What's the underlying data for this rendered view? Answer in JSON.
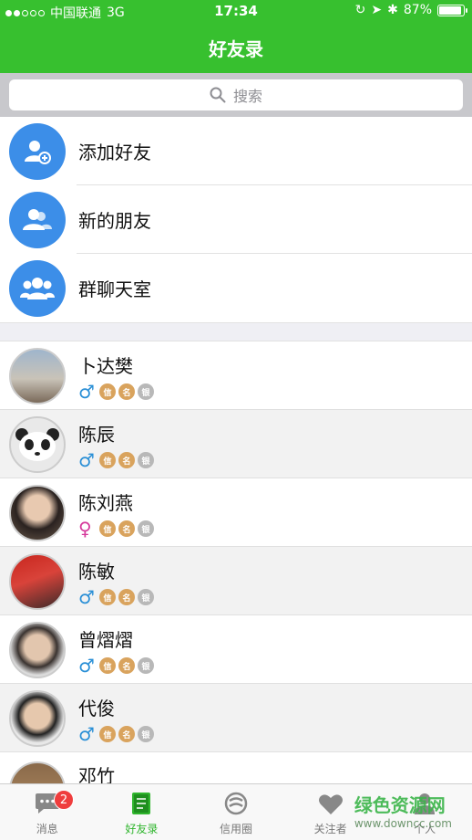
{
  "status_bar": {
    "carrier": "中国联通",
    "network": "3G",
    "time": "17:34",
    "battery": "87%",
    "battery_level": 0.87
  },
  "nav": {
    "title": "好友录"
  },
  "search": {
    "placeholder": "搜索"
  },
  "actions": [
    {
      "label": "添加好友",
      "icon": "add-friend-icon"
    },
    {
      "label": "新的朋友",
      "icon": "new-friends-icon"
    },
    {
      "label": "群聊天室",
      "icon": "group-chat-icon"
    }
  ],
  "contacts": [
    {
      "name": "卜达樊",
      "gender": "male",
      "badges": [
        "信",
        "名",
        "银"
      ]
    },
    {
      "name": "陈辰",
      "gender": "male",
      "badges": [
        "信",
        "名",
        "银"
      ]
    },
    {
      "name": "陈刘燕",
      "gender": "female",
      "badges": [
        "信",
        "名",
        "银"
      ]
    },
    {
      "name": "陈敏",
      "gender": "male",
      "badges": [
        "信",
        "名",
        "银"
      ]
    },
    {
      "name": "曾熠熠",
      "gender": "male",
      "badges": [
        "信",
        "名",
        "银"
      ]
    },
    {
      "name": "代俊",
      "gender": "male",
      "badges": [
        "信",
        "名",
        "银"
      ]
    },
    {
      "name": "邓竹",
      "gender": "",
      "badges": []
    }
  ],
  "tabs": [
    {
      "label": "消息",
      "icon": "chat-icon",
      "badge": "2",
      "active": false
    },
    {
      "label": "好友录",
      "icon": "address-book-icon",
      "active": true
    },
    {
      "label": "信用圈",
      "icon": "credit-circle-icon",
      "active": false
    },
    {
      "label": "关注者",
      "icon": "heart-icon",
      "active": false
    },
    {
      "label": "个人",
      "icon": "person-icon",
      "active": false
    }
  ],
  "watermark": {
    "text": "绿色资源网",
    "sub": "www.downcc.com"
  },
  "colors": {
    "brand": "#37c02f",
    "action_blue": "#3c8ee8",
    "badge_red": "#ef3d3d"
  }
}
